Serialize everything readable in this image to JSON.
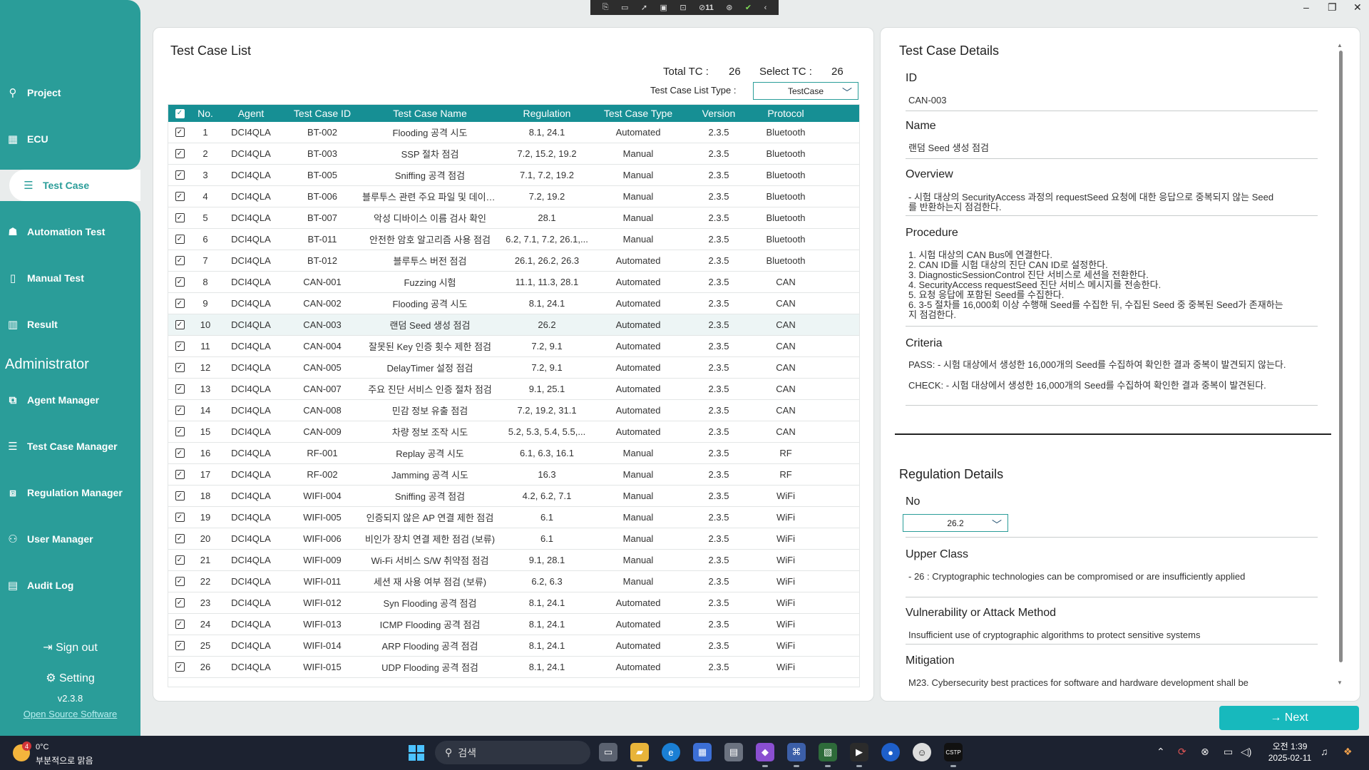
{
  "toolbar_top": {
    "badge_count": "11"
  },
  "sidebar": {
    "items": [
      {
        "label": "Project",
        "icon": "person-icon"
      },
      {
        "label": "ECU",
        "icon": "chip-icon"
      },
      {
        "label": "Test Case",
        "icon": "list-icon"
      },
      {
        "label": "Automation Test",
        "icon": "robot-icon"
      },
      {
        "label": "Manual Test",
        "icon": "flask-icon"
      },
      {
        "label": "Result",
        "icon": "bar-chart-icon"
      }
    ],
    "admin_title": "Administrator",
    "admin_items": [
      {
        "label": "Agent Manager",
        "icon": "agent-icon"
      },
      {
        "label": "Test Case Manager",
        "icon": "list-icon"
      },
      {
        "label": "Regulation Manager",
        "icon": "regulation-icon"
      },
      {
        "label": "User Manager",
        "icon": "user-gear-icon"
      },
      {
        "label": "Audit Log",
        "icon": "document-icon"
      }
    ],
    "sign_out": "Sign out",
    "setting": "Setting",
    "version": "v2.3.8",
    "oss_link": "Open Source Software"
  },
  "list": {
    "title": "Test Case List",
    "total_label": "Total TC :",
    "total_value": "26",
    "select_label": "Select TC :",
    "select_value": "26",
    "type_label": "Test Case List Type :",
    "type_value": "TestCase",
    "columns": [
      "No.",
      "Agent",
      "Test Case ID",
      "Test Case Name",
      "Regulation",
      "Test Case Type",
      "Version",
      "Protocol"
    ],
    "rows": [
      [
        "1",
        "DCI4QLA",
        "BT-002",
        "Flooding 공격 시도",
        "8.1, 24.1",
        "Automated",
        "2.3.5",
        "Bluetooth"
      ],
      [
        "2",
        "DCI4QLA",
        "BT-003",
        "SSP 절차 점검",
        "7.2, 15.2, 19.2",
        "Manual",
        "2.3.5",
        "Bluetooth"
      ],
      [
        "3",
        "DCI4QLA",
        "BT-005",
        "Sniffing 공격 점검",
        "7.1, 7.2, 19.2",
        "Manual",
        "2.3.5",
        "Bluetooth"
      ],
      [
        "4",
        "DCI4QLA",
        "BT-006",
        "블루투스 관련 주요 파일 및 데이터...",
        "7.2, 19.2",
        "Manual",
        "2.3.5",
        "Bluetooth"
      ],
      [
        "5",
        "DCI4QLA",
        "BT-007",
        "악성 디바이스 이름 검사 확인",
        "28.1",
        "Manual",
        "2.3.5",
        "Bluetooth"
      ],
      [
        "6",
        "DCI4QLA",
        "BT-011",
        "안전한 암호 알고리즘 사용 점검",
        "6.2, 7.1, 7.2, 26.1,...",
        "Manual",
        "2.3.5",
        "Bluetooth"
      ],
      [
        "7",
        "DCI4QLA",
        "BT-012",
        "블루투스 버전 점검",
        "26.1, 26.2, 26.3",
        "Automated",
        "2.3.5",
        "Bluetooth"
      ],
      [
        "8",
        "DCI4QLA",
        "CAN-001",
        "Fuzzing 시험",
        "11.1, 11.3, 28.1",
        "Automated",
        "2.3.5",
        "CAN"
      ],
      [
        "9",
        "DCI4QLA",
        "CAN-002",
        "Flooding 공격 시도",
        "8.1, 24.1",
        "Automated",
        "2.3.5",
        "CAN"
      ],
      [
        "10",
        "DCI4QLA",
        "CAN-003",
        "랜덤 Seed 생성 점검",
        "26.2",
        "Automated",
        "2.3.5",
        "CAN"
      ],
      [
        "11",
        "DCI4QLA",
        "CAN-004",
        "잘못된 Key 인증 횟수 제한 점검",
        "7.2, 9.1",
        "Automated",
        "2.3.5",
        "CAN"
      ],
      [
        "12",
        "DCI4QLA",
        "CAN-005",
        "DelayTimer 설정 점검",
        "7.2, 9.1",
        "Automated",
        "2.3.5",
        "CAN"
      ],
      [
        "13",
        "DCI4QLA",
        "CAN-007",
        "주요 진단 서비스 인증 절차 점검",
        "9.1, 25.1",
        "Automated",
        "2.3.5",
        "CAN"
      ],
      [
        "14",
        "DCI4QLA",
        "CAN-008",
        "민감 정보 유출 점검",
        "7.2, 19.2, 31.1",
        "Automated",
        "2.3.5",
        "CAN"
      ],
      [
        "15",
        "DCI4QLA",
        "CAN-009",
        "차량 정보 조작 시도",
        "5.2, 5.3, 5.4, 5.5,...",
        "Automated",
        "2.3.5",
        "CAN"
      ],
      [
        "16",
        "DCI4QLA",
        "RF-001",
        "Replay 공격 시도",
        "6.1, 6.3, 16.1",
        "Manual",
        "2.3.5",
        "RF"
      ],
      [
        "17",
        "DCI4QLA",
        "RF-002",
        "Jamming 공격 시도",
        "16.3",
        "Manual",
        "2.3.5",
        "RF"
      ],
      [
        "18",
        "DCI4QLA",
        "WIFI-004",
        "Sniffing 공격 점검",
        "4.2, 6.2, 7.1",
        "Manual",
        "2.3.5",
        "WiFi"
      ],
      [
        "19",
        "DCI4QLA",
        "WIFI-005",
        "인증되지 않은 AP 연결 제한 점검",
        "6.1",
        "Manual",
        "2.3.5",
        "WiFi"
      ],
      [
        "20",
        "DCI4QLA",
        "WIFI-006",
        "비인가 장치 연결 제한 점검 (보류)",
        "6.1",
        "Manual",
        "2.3.5",
        "WiFi"
      ],
      [
        "21",
        "DCI4QLA",
        "WIFI-009",
        "Wi-Fi 서비스 S/W 취약점 점검",
        "9.1, 28.1",
        "Manual",
        "2.3.5",
        "WiFi"
      ],
      [
        "22",
        "DCI4QLA",
        "WIFI-011",
        "세션 재 사용 여부 점검 (보류)",
        "6.2, 6.3",
        "Manual",
        "2.3.5",
        "WiFi"
      ],
      [
        "23",
        "DCI4QLA",
        "WIFI-012",
        "Syn Flooding 공격 점검",
        "8.1, 24.1",
        "Automated",
        "2.3.5",
        "WiFi"
      ],
      [
        "24",
        "DCI4QLA",
        "WIFI-013",
        "ICMP Flooding 공격 점검",
        "8.1, 24.1",
        "Automated",
        "2.3.5",
        "WiFi"
      ],
      [
        "25",
        "DCI4QLA",
        "WIFI-014",
        "ARP Flooding 공격 점검",
        "8.1, 24.1",
        "Automated",
        "2.3.5",
        "WiFi"
      ],
      [
        "26",
        "DCI4QLA",
        "WIFI-015",
        "UDP Flooding 공격 점검",
        "8.1, 24.1",
        "Automated",
        "2.3.5",
        "WiFi"
      ]
    ],
    "selected_row": "10"
  },
  "details": {
    "title": "Test Case Details",
    "id_label": "ID",
    "id_value": "CAN-003",
    "name_label": "Name",
    "name_value": "랜덤 Seed 생성 점검",
    "overview_label": "Overview",
    "overview_lines": [
      "- 시험 대상의 SecurityAccess 과정의 requestSeed 요청에 대한 응답으로 중복되지 않는 Seed",
      "를 반환하는지 점검한다."
    ],
    "procedure_label": "Procedure",
    "procedure_lines": [
      "1. 시험 대상의 CAN Bus에 연결한다.",
      "2. CAN ID를 시험 대상의 진단 CAN ID로 설정한다.",
      "3. DiagnosticSessionControl 진단 서비스로 세션을 전환한다.",
      "4. SecurityAccess requestSeed 진단 서비스 메시지를 전송한다.",
      "5. 요청 응답에 포함된 Seed를 수집한다.",
      "6. 3-5 절차를 16,000회 이상 수행해 Seed를 수집한 뒤, 수집된 Seed 중 중복된 Seed가 존재하는",
      "지 점검한다."
    ],
    "criteria_label": "Criteria",
    "criteria_pass": "PASS: - 시험 대상에서 생성한 16,000개의 Seed를 수집하여 확인한 결과 중복이 발견되지 않는다.",
    "criteria_check": "CHECK: - 시험 대상에서 생성한 16,000개의 Seed를 수집하여 확인한 결과 중복이 발견된다."
  },
  "regulation": {
    "title": "Regulation Details",
    "no_label": "No",
    "no_value": "26.2",
    "upper_label": "Upper Class",
    "upper_value": "- 26 : Cryptographic technologies can be compromised or are insufficiently applied",
    "vuln_label": "Vulnerability or Attack Method",
    "vuln_value": "Insufficient use of cryptographic algorithms to protect sensitive systems",
    "mitigation_label": "Mitigation",
    "mitigation_value": "M23. Cybersecurity best practices for software and hardware development shall be"
  },
  "next_button": "Next",
  "taskbar": {
    "weather_temp": "0°C",
    "weather_desc": "부분적으로 맑음",
    "weather_badge": "4",
    "search_placeholder": "검색",
    "time": "오전 1:39",
    "date": "2025-02-11"
  }
}
